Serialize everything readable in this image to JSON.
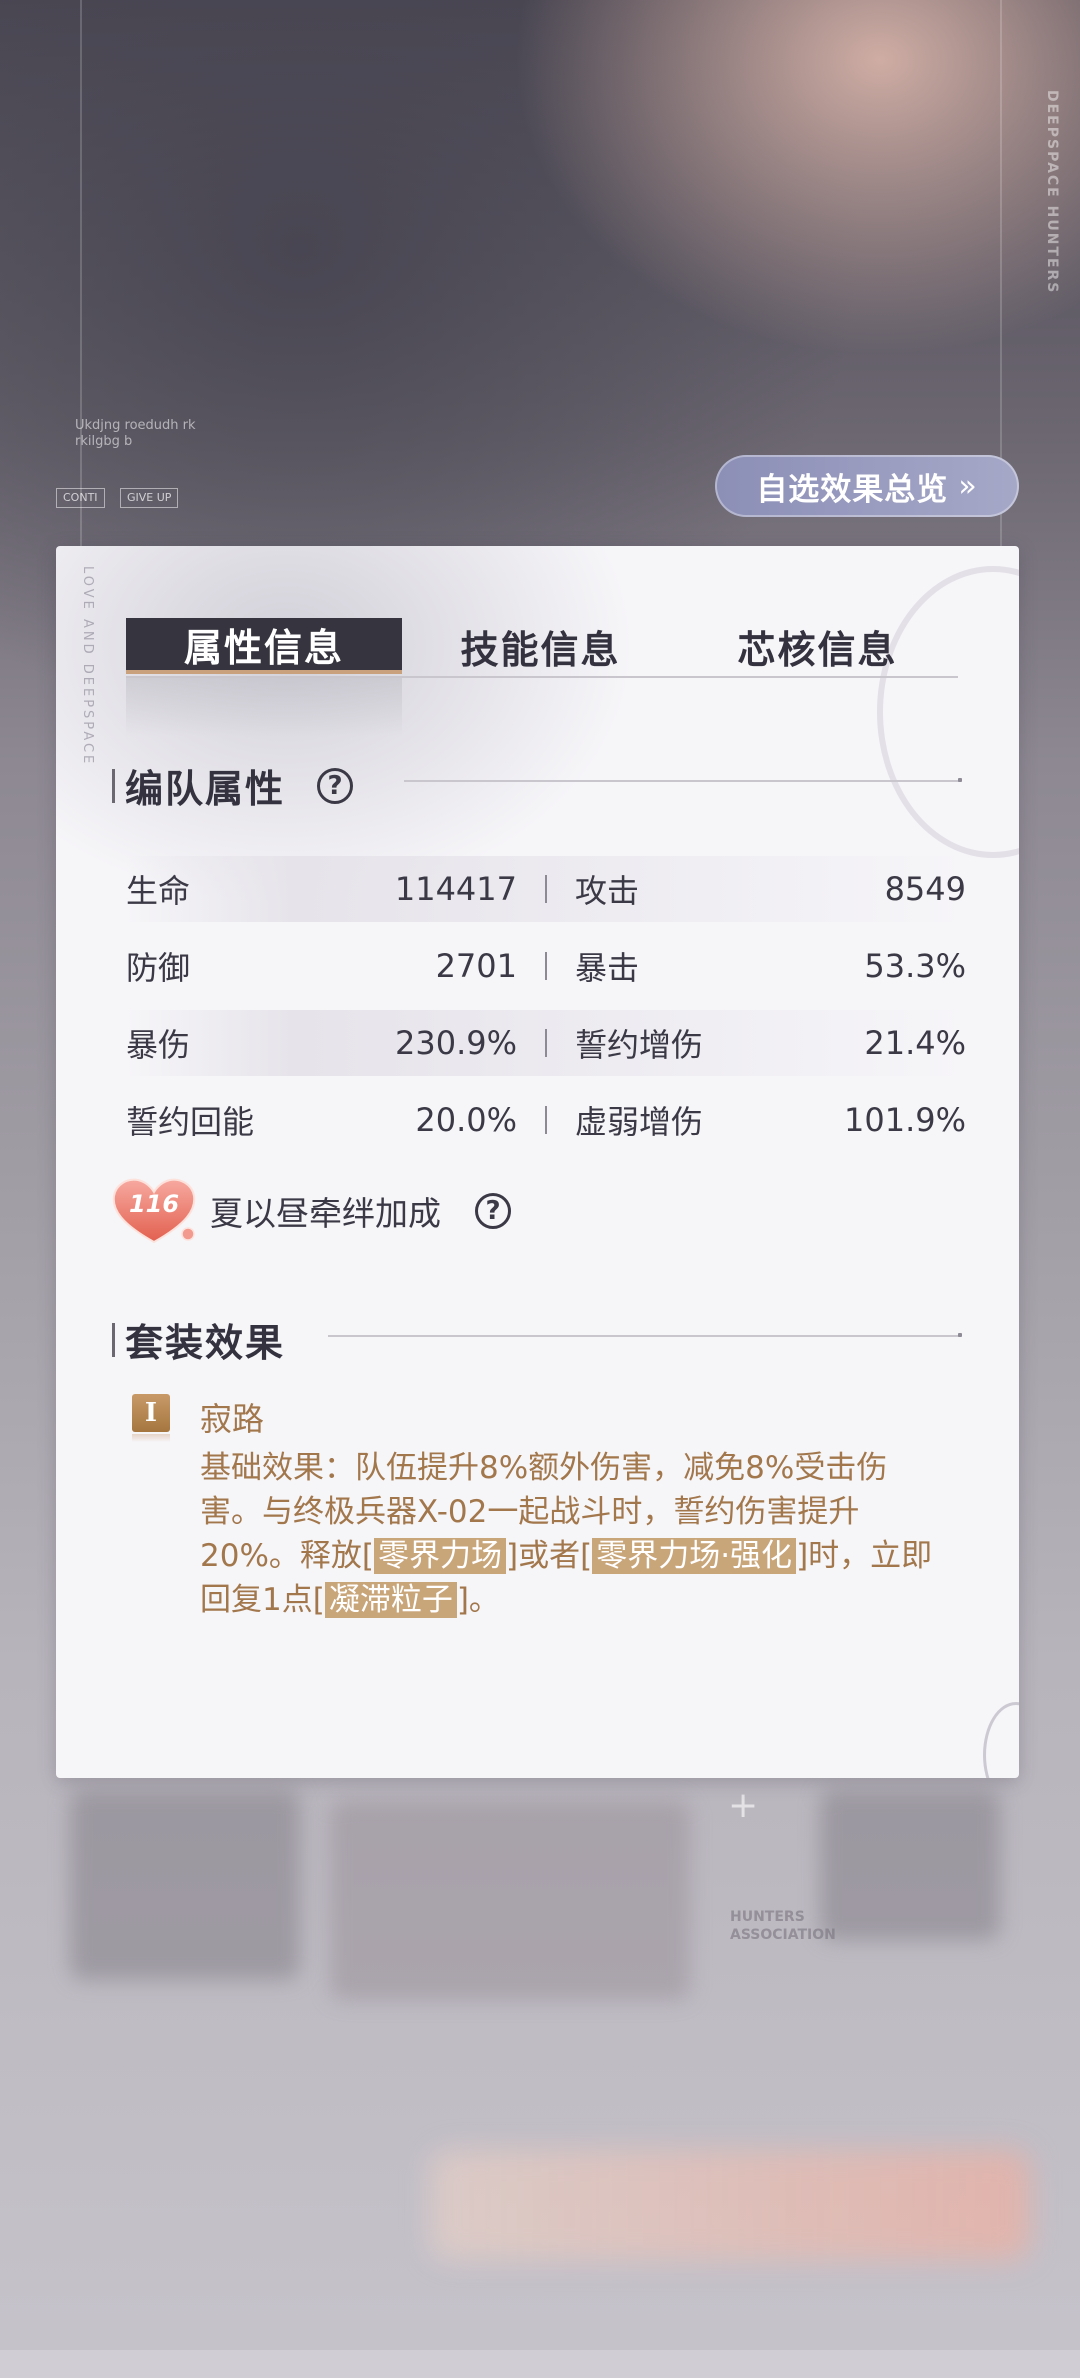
{
  "background": {
    "brand_vertical": "DEEPSPACE HUNTERS",
    "small_text": "Ukdjng roedudh rk\nrkilgbg b",
    "chip_1": "CONTI",
    "chip_2": "GIVE UP",
    "association": "HUNTERS\nASSOCIATION"
  },
  "overview_button": {
    "label": "自选效果总览",
    "chevron": "»"
  },
  "panel": {
    "vertical_text": "LOVE AND DEEPSPACE",
    "tabs": [
      {
        "label": "属性信息",
        "active": true
      },
      {
        "label": "技能信息",
        "active": false
      },
      {
        "label": "芯核信息",
        "active": false
      }
    ],
    "team_attributes": {
      "title": "编队属性",
      "help": "?",
      "rows": [
        {
          "left_label": "生命",
          "left_value": "114417",
          "right_label": "攻击",
          "right_value": "8549"
        },
        {
          "left_label": "防御",
          "left_value": "2701",
          "right_label": "暴击",
          "right_value": "53.3%"
        },
        {
          "left_label": "暴伤",
          "left_value": "230.9%",
          "right_label": "誓约增伤",
          "right_value": "21.4%"
        },
        {
          "left_label": "誓约回能",
          "left_value": "20.0%",
          "right_label": "虚弱增伤",
          "right_value": "101.9%"
        }
      ]
    },
    "bond": {
      "level": "116",
      "label": "夏以昼牵绊加成",
      "help": "?"
    },
    "set_effect": {
      "title": "套装效果",
      "items": [
        {
          "badge": "I",
          "name": "寂路",
          "desc_part1": "基础效果：队伍提升8%额外伤害，减免8%受击伤害。与终极兵器X-02一起战斗时，誓约伤害提升20%。释放[",
          "kw1": "零界力场",
          "desc_part2": "]或者[",
          "kw2": "零界力场·强化",
          "desc_part3": "]时，立即回复1点[",
          "kw3": "凝滞粒子",
          "desc_part4": "]。"
        }
      ]
    }
  },
  "colors": {
    "accent_gold": "#c9a27d",
    "set_text": "#a2774c",
    "active_tab": "#36353f",
    "button": "#9a9cc0"
  }
}
